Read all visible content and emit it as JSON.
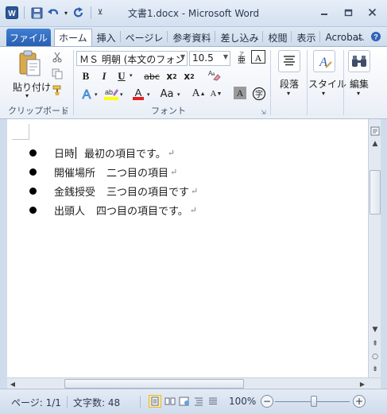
{
  "window": {
    "title": "文書1.docx - Microsoft Word",
    "app_icon": "word-icon"
  },
  "tabs": {
    "file": "ファイル",
    "items": [
      "ホーム",
      "挿入",
      "ページレ",
      "参考資料",
      "差し込み",
      "校閲",
      "表示",
      "Acrobat"
    ],
    "active": "ホーム"
  },
  "ribbon": {
    "clipboard": {
      "paste_label": "貼り付け",
      "group_label": "クリップボード"
    },
    "font": {
      "font_name": "ＭＳ 明朝 (本文のフォン",
      "font_size": "10.5",
      "group_label": "フォント"
    },
    "paragraph": {
      "label": "段落"
    },
    "styles": {
      "label": "スタイル"
    },
    "editing": {
      "label": "編集"
    }
  },
  "document": {
    "items": [
      {
        "text": "日時",
        "rest": "最初の項目です。",
        "mark": "↵"
      },
      {
        "text": "開催場所",
        "rest": "二つ目の項目",
        "mark": "↵"
      },
      {
        "text": "金銭授受",
        "rest": "三つ目の項目です",
        "mark": "↵"
      },
      {
        "text": "出頭人",
        "rest": "四つ目の項目です。",
        "mark": "↵"
      }
    ]
  },
  "statusbar": {
    "page": "ページ: 1/1",
    "word_count": "文字数: 48",
    "zoom": "100%",
    "zoom_level_percent": 100
  }
}
